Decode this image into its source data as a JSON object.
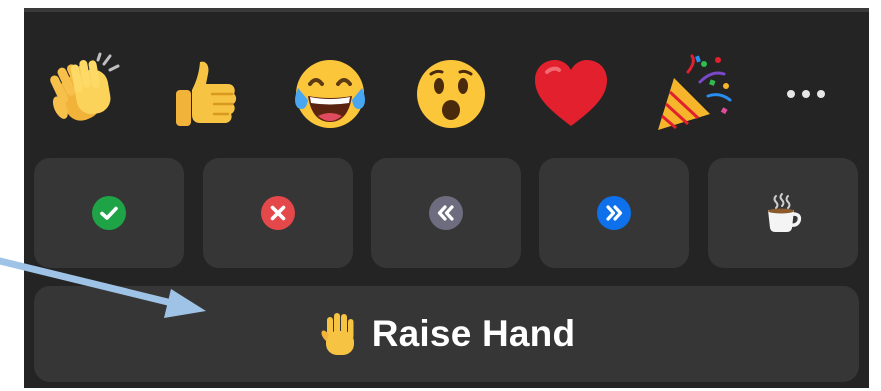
{
  "reactions": {
    "emojis": [
      {
        "icon": "clapping-hands-icon"
      },
      {
        "icon": "thumbs-up-icon"
      },
      {
        "icon": "tears-of-joy-icon"
      },
      {
        "icon": "open-mouth-icon"
      },
      {
        "icon": "red-heart-icon"
      },
      {
        "icon": "party-popper-icon"
      }
    ],
    "more_icon": "ellipsis-icon"
  },
  "feedback": {
    "buttons": [
      {
        "icon": "check-icon",
        "color": "#1ea446"
      },
      {
        "icon": "cross-icon",
        "color": "#e5484a"
      },
      {
        "icon": "rewind-icon",
        "color": "#6e6d80"
      },
      {
        "icon": "fast-forward-icon",
        "color": "#0e71eb"
      },
      {
        "icon": "coffee-icon"
      }
    ]
  },
  "raise_hand": {
    "label": "Raise Hand",
    "icon": "raised-hand-icon"
  },
  "colors": {
    "panel": "#242424",
    "button": "#363636",
    "annotation_arrow": "#9fc3e6"
  }
}
